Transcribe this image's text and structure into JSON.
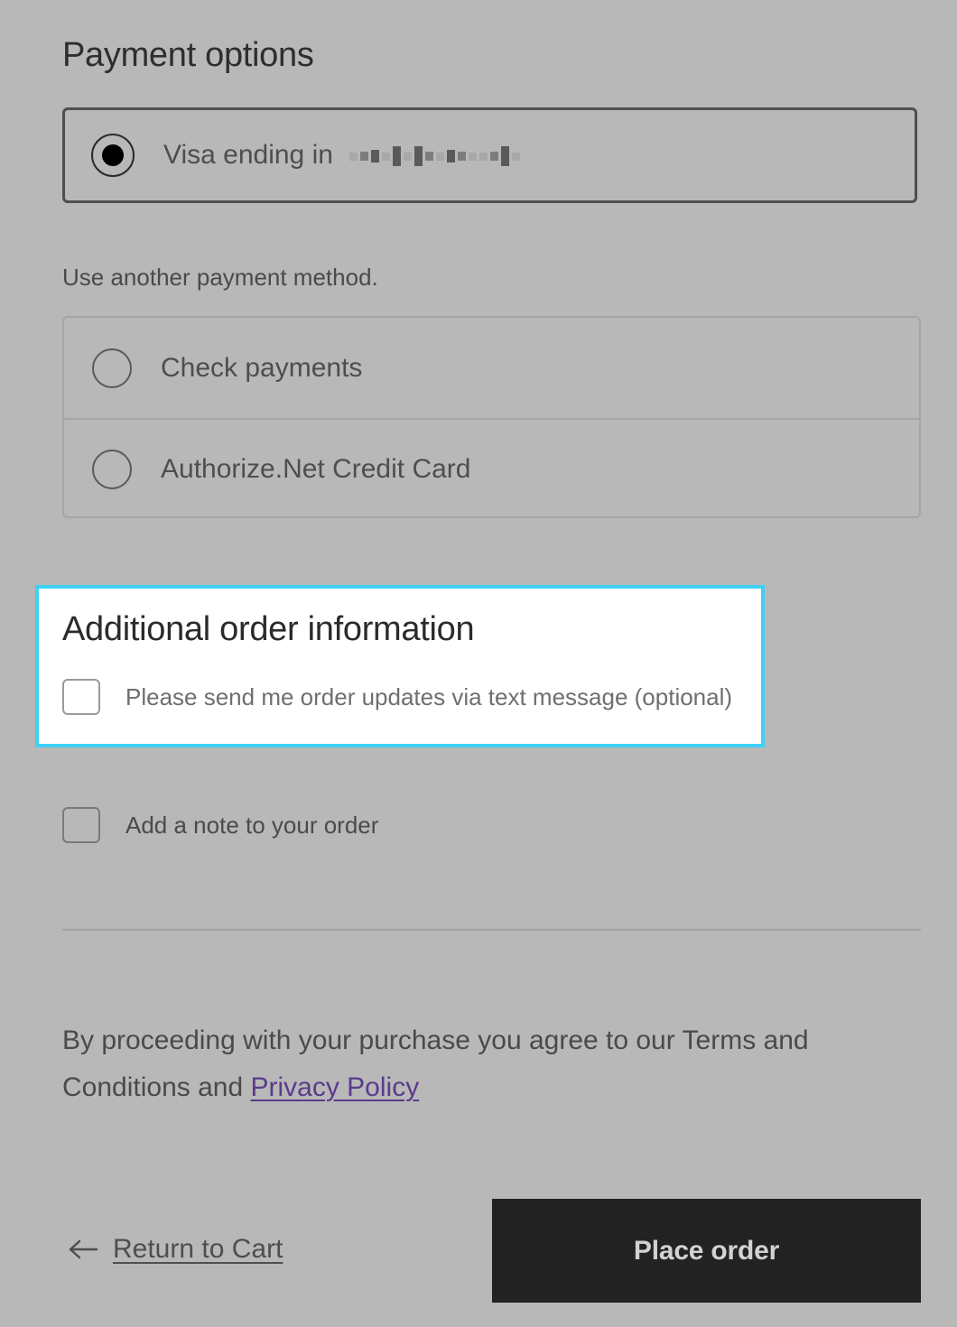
{
  "payment": {
    "title": "Payment options",
    "saved_method": {
      "label": "Visa ending in",
      "masked_number": "(redacted)",
      "selected": true
    },
    "another_method_label": "Use another payment method.",
    "options": [
      {
        "label": "Check payments",
        "selected": false
      },
      {
        "label": "Authorize.Net Credit Card",
        "selected": false
      }
    ]
  },
  "additional_info": {
    "title": "Additional order information",
    "sms_checkbox_label": "Please send me order updates via text message (optional)",
    "sms_checked": false,
    "highlight_color": "#3fd0f5"
  },
  "note": {
    "checkbox_label": "Add a note to your order",
    "checked": false
  },
  "terms": {
    "prefix": "By proceeding with your purchase you agree to our Terms and Conditions and ",
    "privacy_link": "Privacy Policy",
    "link_color": "#5b3b8c"
  },
  "actions": {
    "return_icon": "arrow-left-icon",
    "return_label": "Return to Cart",
    "place_order_label": "Place order",
    "place_order_bg": "#222222"
  }
}
